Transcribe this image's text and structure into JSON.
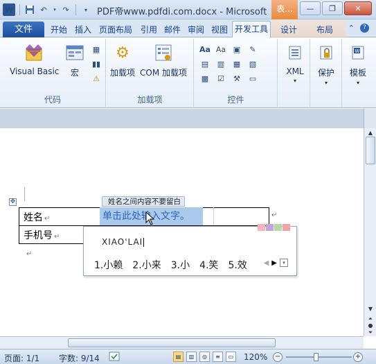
{
  "window": {
    "title": "PDF帝www.pdfdi.com.docx - Microsoft",
    "contextual_tab_title": "表...",
    "minimize_icon": "minimize-icon",
    "restore_icon": "restore-icon",
    "close_icon": "close-icon"
  },
  "ribbon": {
    "file_tab": "文件",
    "tabs": [
      "开始",
      "插入",
      "页面布局",
      "引用",
      "邮件",
      "审阅",
      "视图",
      "开发工具",
      "设计",
      "布局"
    ],
    "active_tab": "开发工具",
    "groups": {
      "code": {
        "label": "代码",
        "visual_basic": "Visual Basic",
        "macros": "宏"
      },
      "addins": {
        "label": "加载项",
        "addins": "加载项",
        "com_addins": "COM 加载项"
      },
      "controls": {
        "label": "控件"
      },
      "xml": "XML",
      "protect": "保护",
      "templates": "模板"
    }
  },
  "document": {
    "table": {
      "row1_label": "姓名",
      "row2_label": "手机号"
    },
    "content_control": {
      "title": "姓名之间内容不要留白",
      "placeholder": "单击此处输入文字。"
    },
    "ime": {
      "pinyin": "XIAO'LAI",
      "candidates": [
        "1.小赖",
        "2.小来",
        "3.小",
        "4.笑",
        "5.效"
      ],
      "palette": [
        "#f4b6bd",
        "#c3a6d9",
        "#b7d7a8",
        "#f6a2a2"
      ]
    }
  },
  "status": {
    "page": "页面: 1/1",
    "words": "字数: 9/14",
    "zoom": "120%",
    "zoom_level": 120
  },
  "colors": {
    "accent": "#2b5797",
    "content_control_fill": "#abc9ea",
    "contextual_tab": "#e9893c"
  }
}
